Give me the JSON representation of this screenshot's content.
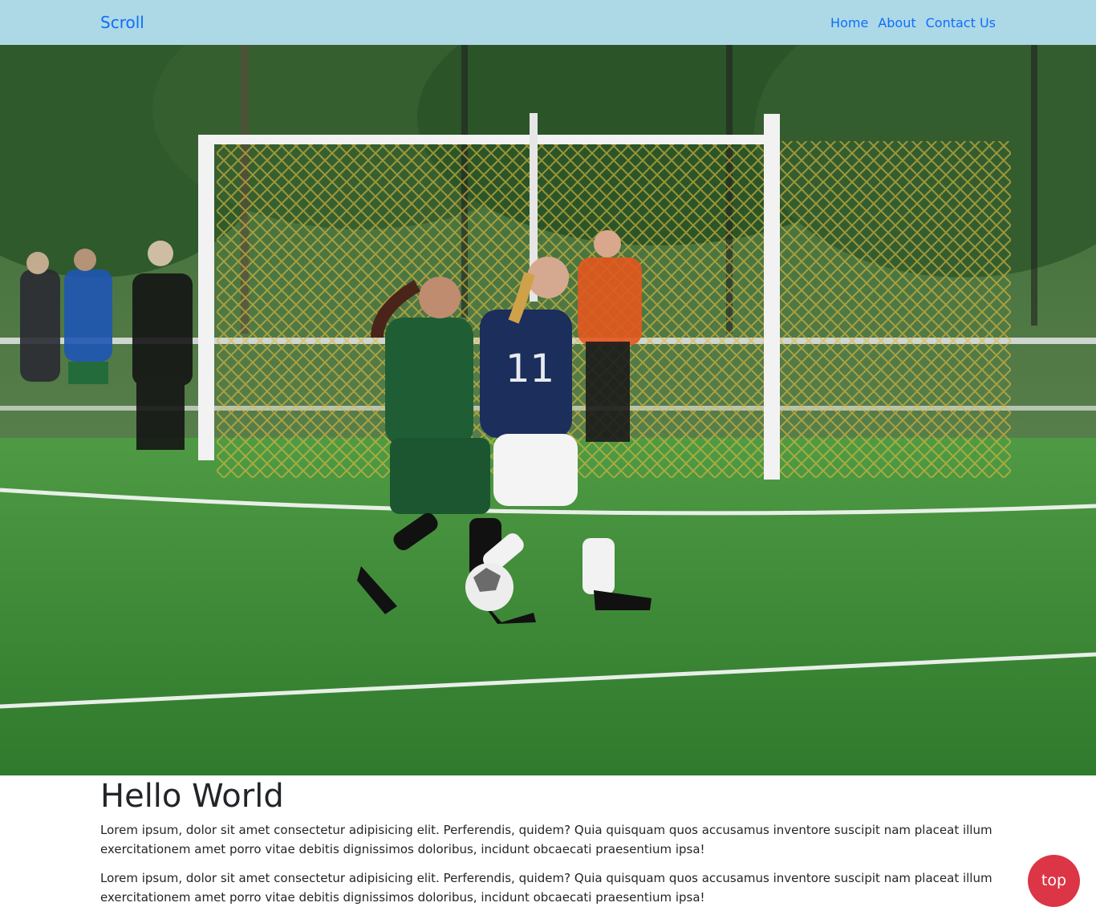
{
  "navbar": {
    "brand": "Scroll",
    "links": [
      {
        "label": "Home"
      },
      {
        "label": "About"
      },
      {
        "label": "Contact Us"
      }
    ]
  },
  "hero": {
    "image_subject": "soccer-match-photo",
    "colors": {
      "turf": "#3f8a3a",
      "trees": "#2f5a2c",
      "green_jersey": "#1f5e35",
      "navy_jersey": "#1b2e5c",
      "net": "#d8b73e"
    }
  },
  "main": {
    "title": "Hello World",
    "paragraphs": [
      "Lorem ipsum, dolor sit amet consectetur adipisicing elit. Perferendis, quidem? Quia quisquam quos accusamus inventore suscipit nam placeat illum exercitationem amet porro vitae debitis dignissimos doloribus, incidunt obcaecati praesentium ipsa!",
      "Lorem ipsum, dolor sit amet consectetur adipisicing elit. Perferendis, quidem? Quia quisquam quos accusamus inventore suscipit nam placeat illum exercitationem amet porro vitae debitis dignissimos doloribus, incidunt obcaecati praesentium ipsa!"
    ]
  },
  "scroll_top": {
    "label": "top",
    "color": "#dc3545"
  }
}
